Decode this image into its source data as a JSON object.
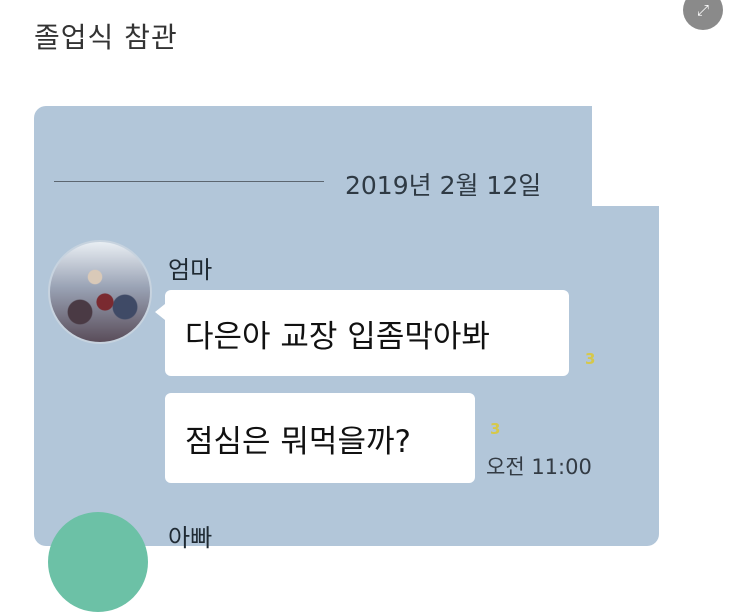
{
  "post": {
    "title": "졸업식 참관"
  },
  "controls": {
    "expand_icon": "expand-icon",
    "expand_glyph": "⤢"
  },
  "chat": {
    "date": "2019년 2월 12일",
    "background_color": "#b2c6d9",
    "messages": [
      {
        "sender": "엄마",
        "text": "다은아 교장 입좀막아봐",
        "unread": "3"
      },
      {
        "sender": "엄마",
        "text": "점심은 뭐먹을까?",
        "unread": "3",
        "time": "오전 11:00"
      }
    ],
    "next_sender": "아빠"
  }
}
